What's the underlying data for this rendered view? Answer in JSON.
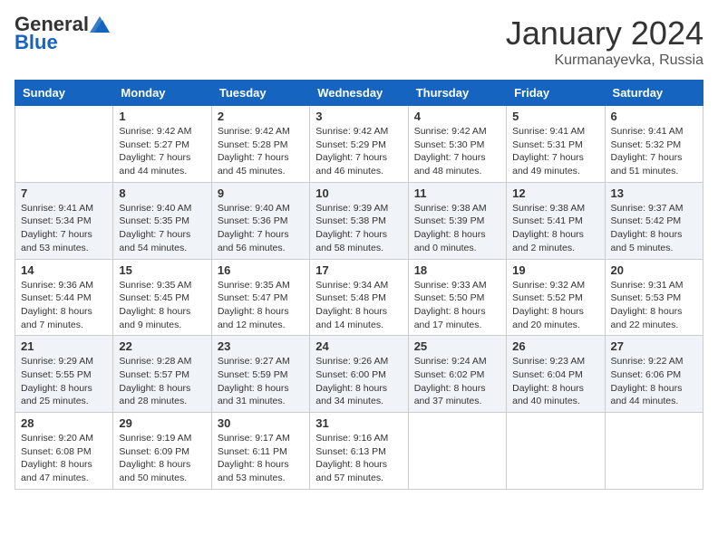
{
  "header": {
    "logo": {
      "general": "General",
      "blue": "Blue"
    },
    "title": "January 2024",
    "location": "Kurmanayevka, Russia"
  },
  "weekdays": [
    "Sunday",
    "Monday",
    "Tuesday",
    "Wednesday",
    "Thursday",
    "Friday",
    "Saturday"
  ],
  "weeks": [
    [
      {
        "day": "",
        "sunrise": "",
        "sunset": "",
        "daylight": ""
      },
      {
        "day": "1",
        "sunrise": "Sunrise: 9:42 AM",
        "sunset": "Sunset: 5:27 PM",
        "daylight": "Daylight: 7 hours and 44 minutes."
      },
      {
        "day": "2",
        "sunrise": "Sunrise: 9:42 AM",
        "sunset": "Sunset: 5:28 PM",
        "daylight": "Daylight: 7 hours and 45 minutes."
      },
      {
        "day": "3",
        "sunrise": "Sunrise: 9:42 AM",
        "sunset": "Sunset: 5:29 PM",
        "daylight": "Daylight: 7 hours and 46 minutes."
      },
      {
        "day": "4",
        "sunrise": "Sunrise: 9:42 AM",
        "sunset": "Sunset: 5:30 PM",
        "daylight": "Daylight: 7 hours and 48 minutes."
      },
      {
        "day": "5",
        "sunrise": "Sunrise: 9:41 AM",
        "sunset": "Sunset: 5:31 PM",
        "daylight": "Daylight: 7 hours and 49 minutes."
      },
      {
        "day": "6",
        "sunrise": "Sunrise: 9:41 AM",
        "sunset": "Sunset: 5:32 PM",
        "daylight": "Daylight: 7 hours and 51 minutes."
      }
    ],
    [
      {
        "day": "7",
        "sunrise": "Sunrise: 9:41 AM",
        "sunset": "Sunset: 5:34 PM",
        "daylight": "Daylight: 7 hours and 53 minutes."
      },
      {
        "day": "8",
        "sunrise": "Sunrise: 9:40 AM",
        "sunset": "Sunset: 5:35 PM",
        "daylight": "Daylight: 7 hours and 54 minutes."
      },
      {
        "day": "9",
        "sunrise": "Sunrise: 9:40 AM",
        "sunset": "Sunset: 5:36 PM",
        "daylight": "Daylight: 7 hours and 56 minutes."
      },
      {
        "day": "10",
        "sunrise": "Sunrise: 9:39 AM",
        "sunset": "Sunset: 5:38 PM",
        "daylight": "Daylight: 7 hours and 58 minutes."
      },
      {
        "day": "11",
        "sunrise": "Sunrise: 9:38 AM",
        "sunset": "Sunset: 5:39 PM",
        "daylight": "Daylight: 8 hours and 0 minutes."
      },
      {
        "day": "12",
        "sunrise": "Sunrise: 9:38 AM",
        "sunset": "Sunset: 5:41 PM",
        "daylight": "Daylight: 8 hours and 2 minutes."
      },
      {
        "day": "13",
        "sunrise": "Sunrise: 9:37 AM",
        "sunset": "Sunset: 5:42 PM",
        "daylight": "Daylight: 8 hours and 5 minutes."
      }
    ],
    [
      {
        "day": "14",
        "sunrise": "Sunrise: 9:36 AM",
        "sunset": "Sunset: 5:44 PM",
        "daylight": "Daylight: 8 hours and 7 minutes."
      },
      {
        "day": "15",
        "sunrise": "Sunrise: 9:35 AM",
        "sunset": "Sunset: 5:45 PM",
        "daylight": "Daylight: 8 hours and 9 minutes."
      },
      {
        "day": "16",
        "sunrise": "Sunrise: 9:35 AM",
        "sunset": "Sunset: 5:47 PM",
        "daylight": "Daylight: 8 hours and 12 minutes."
      },
      {
        "day": "17",
        "sunrise": "Sunrise: 9:34 AM",
        "sunset": "Sunset: 5:48 PM",
        "daylight": "Daylight: 8 hours and 14 minutes."
      },
      {
        "day": "18",
        "sunrise": "Sunrise: 9:33 AM",
        "sunset": "Sunset: 5:50 PM",
        "daylight": "Daylight: 8 hours and 17 minutes."
      },
      {
        "day": "19",
        "sunrise": "Sunrise: 9:32 AM",
        "sunset": "Sunset: 5:52 PM",
        "daylight": "Daylight: 8 hours and 20 minutes."
      },
      {
        "day": "20",
        "sunrise": "Sunrise: 9:31 AM",
        "sunset": "Sunset: 5:53 PM",
        "daylight": "Daylight: 8 hours and 22 minutes."
      }
    ],
    [
      {
        "day": "21",
        "sunrise": "Sunrise: 9:29 AM",
        "sunset": "Sunset: 5:55 PM",
        "daylight": "Daylight: 8 hours and 25 minutes."
      },
      {
        "day": "22",
        "sunrise": "Sunrise: 9:28 AM",
        "sunset": "Sunset: 5:57 PM",
        "daylight": "Daylight: 8 hours and 28 minutes."
      },
      {
        "day": "23",
        "sunrise": "Sunrise: 9:27 AM",
        "sunset": "Sunset: 5:59 PM",
        "daylight": "Daylight: 8 hours and 31 minutes."
      },
      {
        "day": "24",
        "sunrise": "Sunrise: 9:26 AM",
        "sunset": "Sunset: 6:00 PM",
        "daylight": "Daylight: 8 hours and 34 minutes."
      },
      {
        "day": "25",
        "sunrise": "Sunrise: 9:24 AM",
        "sunset": "Sunset: 6:02 PM",
        "daylight": "Daylight: 8 hours and 37 minutes."
      },
      {
        "day": "26",
        "sunrise": "Sunrise: 9:23 AM",
        "sunset": "Sunset: 6:04 PM",
        "daylight": "Daylight: 8 hours and 40 minutes."
      },
      {
        "day": "27",
        "sunrise": "Sunrise: 9:22 AM",
        "sunset": "Sunset: 6:06 PM",
        "daylight": "Daylight: 8 hours and 44 minutes."
      }
    ],
    [
      {
        "day": "28",
        "sunrise": "Sunrise: 9:20 AM",
        "sunset": "Sunset: 6:08 PM",
        "daylight": "Daylight: 8 hours and 47 minutes."
      },
      {
        "day": "29",
        "sunrise": "Sunrise: 9:19 AM",
        "sunset": "Sunset: 6:09 PM",
        "daylight": "Daylight: 8 hours and 50 minutes."
      },
      {
        "day": "30",
        "sunrise": "Sunrise: 9:17 AM",
        "sunset": "Sunset: 6:11 PM",
        "daylight": "Daylight: 8 hours and 53 minutes."
      },
      {
        "day": "31",
        "sunrise": "Sunrise: 9:16 AM",
        "sunset": "Sunset: 6:13 PM",
        "daylight": "Daylight: 8 hours and 57 minutes."
      },
      {
        "day": "",
        "sunrise": "",
        "sunset": "",
        "daylight": ""
      },
      {
        "day": "",
        "sunrise": "",
        "sunset": "",
        "daylight": ""
      },
      {
        "day": "",
        "sunrise": "",
        "sunset": "",
        "daylight": ""
      }
    ]
  ]
}
